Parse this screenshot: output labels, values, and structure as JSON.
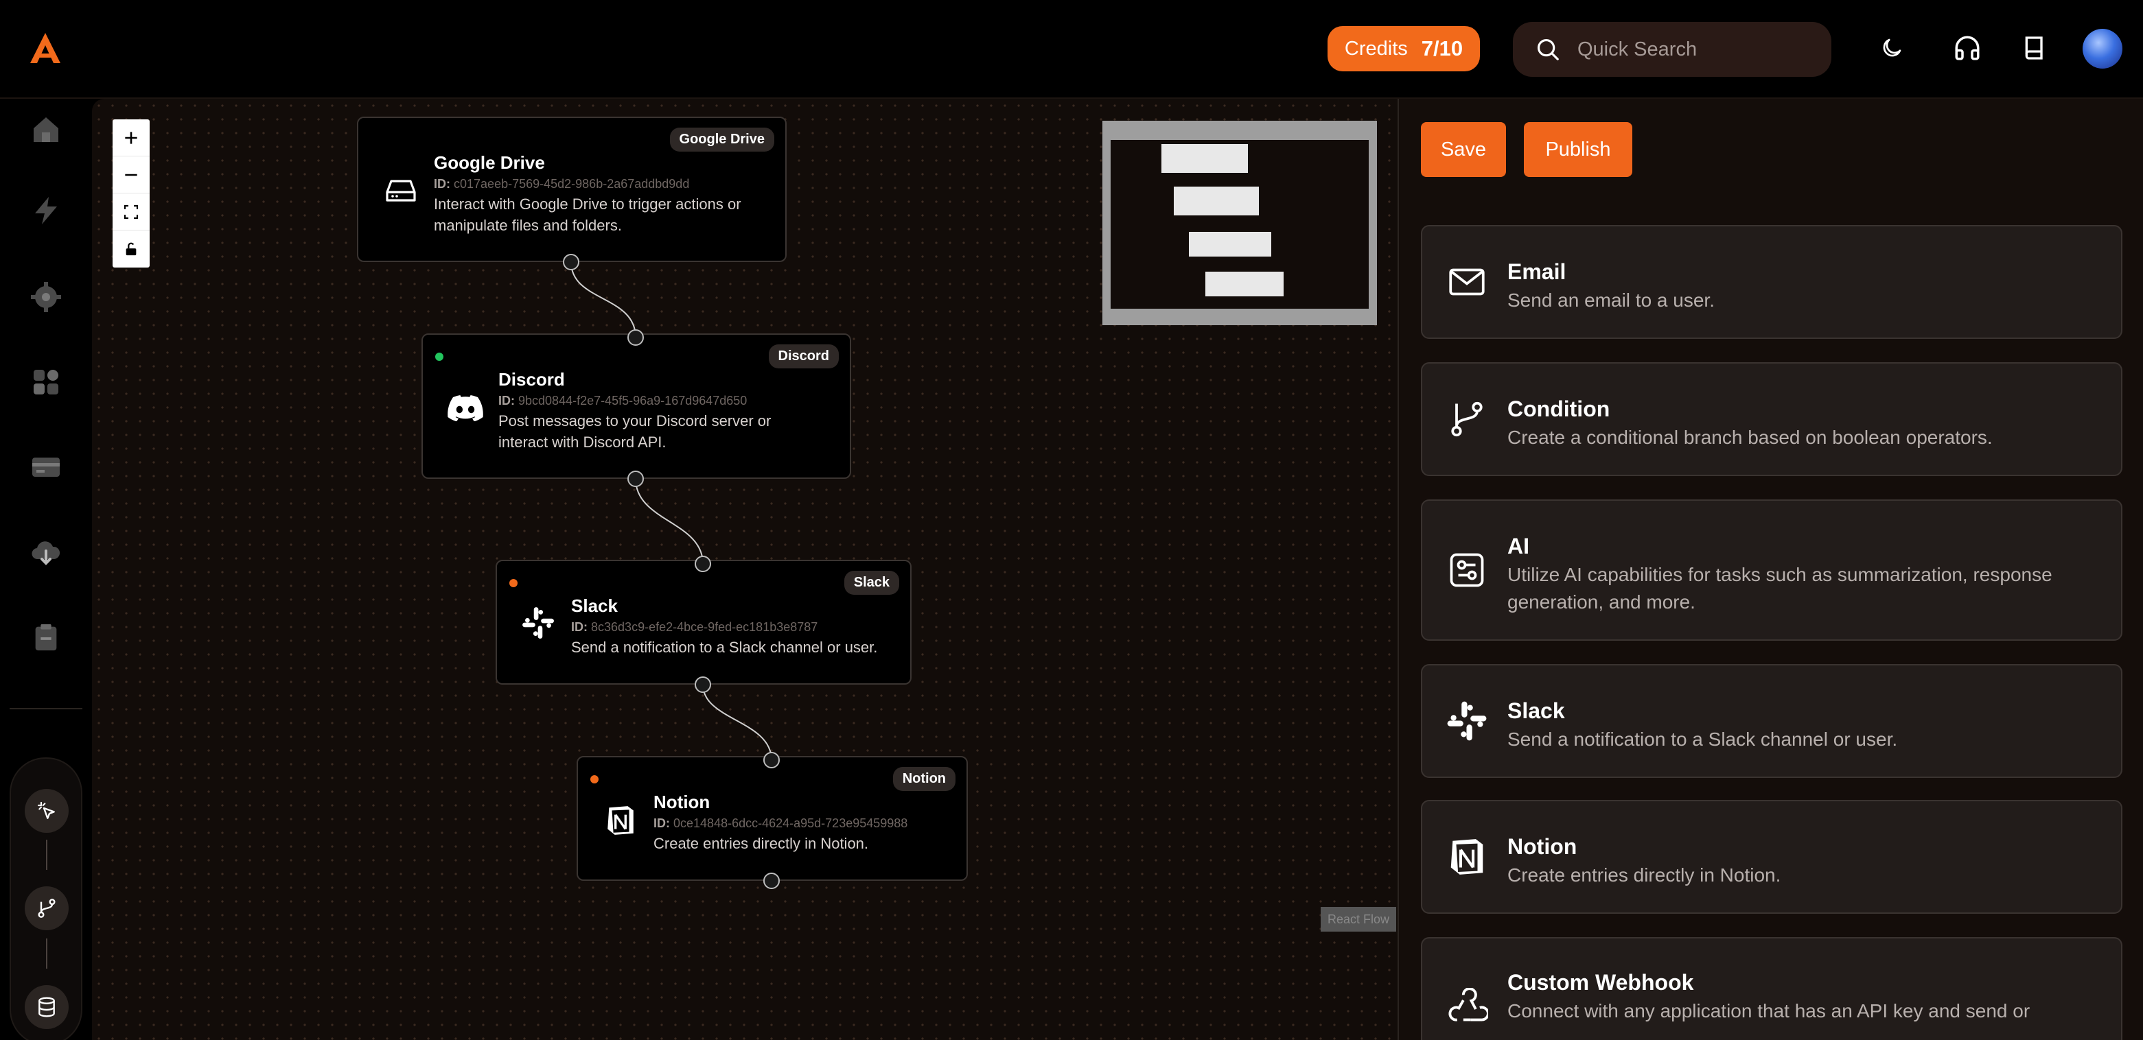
{
  "header": {
    "credits_label": "Credits",
    "credits_count": "7/10",
    "search_placeholder": "Quick Search"
  },
  "canvas": {
    "attribution": "React Flow",
    "nodes": [
      {
        "tag": "Google Drive",
        "title": "Google Drive",
        "id_label": "ID:",
        "id_value": "c017aeeb-7569-45d2-986b-2a67addbd9dd",
        "description_line1": "Interact with Google Drive to trigger actions or",
        "description_line2": "manipulate files and folders.",
        "icon": "hard-drive-icon"
      },
      {
        "tag": "Discord",
        "title": "Discord",
        "id_label": "ID:",
        "id_value": "9bcd0844-f2e7-45f5-96a9-167d9647d650",
        "description_line1": "Post messages to your Discord server or",
        "description_line2": "interact with Discord API.",
        "icon": "discord-icon",
        "status_color": "#22c55e"
      },
      {
        "tag": "Slack",
        "title": "Slack",
        "id_label": "ID:",
        "id_value": "8c36d3c9-efe2-4bce-9fed-ec181b3e8787",
        "description_line1": "Send a notification to a Slack channel or user.",
        "icon": "slack-icon",
        "status_color": "#f26a1b"
      },
      {
        "tag": "Notion",
        "title": "Notion",
        "id_label": "ID:",
        "id_value": "0ce14848-6dcc-4624-a95d-723e95459988",
        "description_line1": "Create entries directly in Notion.",
        "icon": "notion-icon",
        "status_color": "#f26a1b"
      }
    ]
  },
  "panel": {
    "save_label": "Save",
    "publish_label": "Publish",
    "cards": [
      {
        "title": "Email",
        "description": "Send an email to a user.",
        "icon": "mail-icon"
      },
      {
        "title": "Condition",
        "description": "Create a conditional branch based on boolean operators.",
        "icon": "git-branch-icon"
      },
      {
        "title": "AI",
        "description": "Utilize AI capabilities for tasks such as summarization, response generation, and more.",
        "icon": "ai-icon"
      },
      {
        "title": "Slack",
        "description": "Send a notification to a Slack channel or user.",
        "icon": "slack-icon"
      },
      {
        "title": "Notion",
        "description": "Create entries directly in Notion.",
        "icon": "notion-icon"
      },
      {
        "title": "Custom Webhook",
        "description": "Connect with any application that has an API key and send or",
        "icon": "webhook-icon"
      }
    ]
  },
  "colors": {
    "accent": "#f26a1b",
    "background": "#000000",
    "canvas": "#120c09"
  }
}
